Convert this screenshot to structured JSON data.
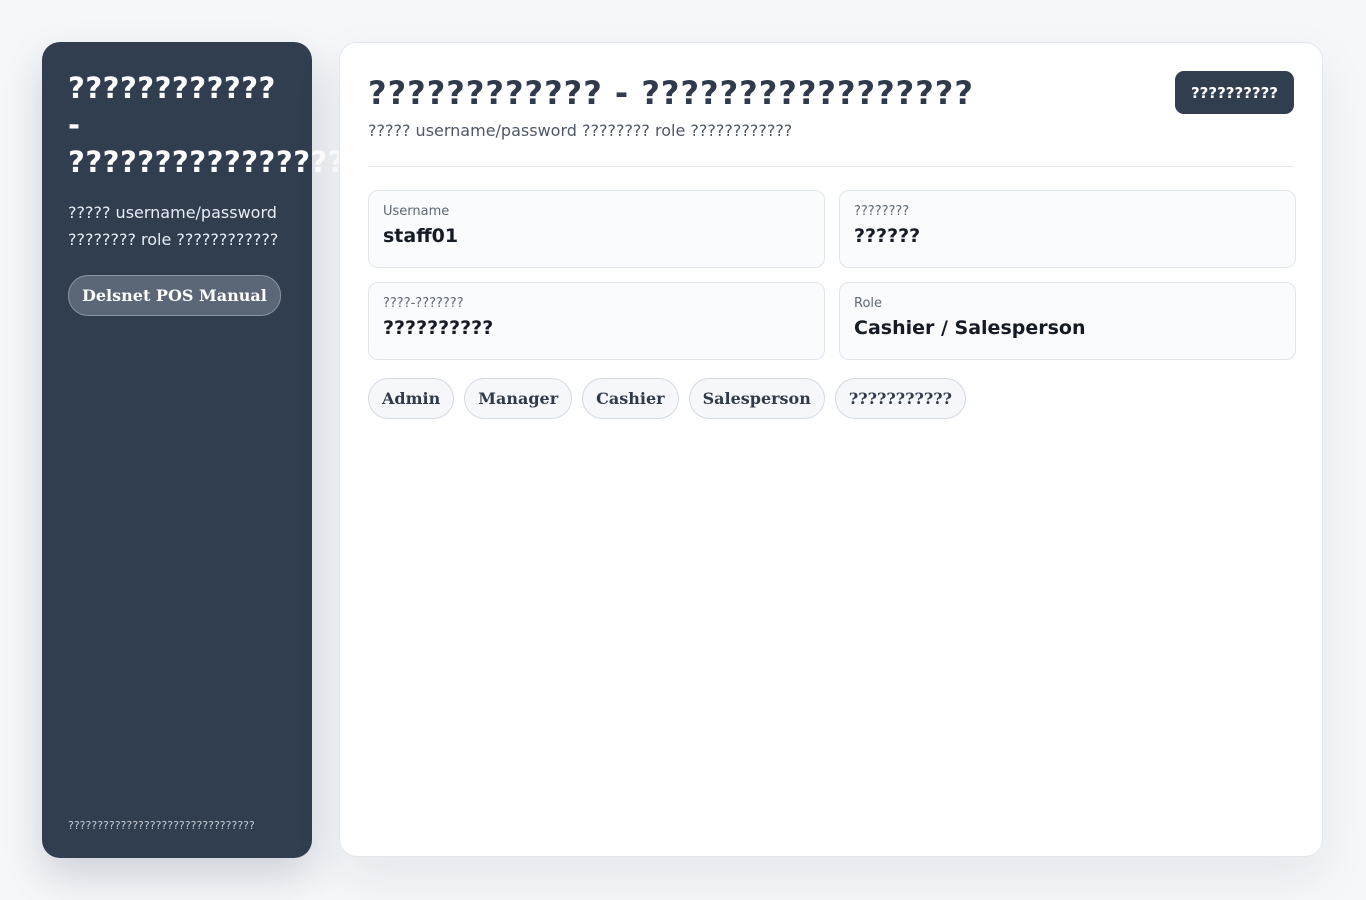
{
  "sidebar": {
    "title_lines": [
      "????????????",
      "-",
      "????????????????"
    ],
    "description": "????? username/password ???????? role ????????????",
    "manual_link": "Delsnet POS Manual",
    "footer": "????????????????????????????????"
  },
  "header": {
    "title": "???????????? - ?????????????????",
    "subtitle": "????? username/password ???????? role ????????????",
    "action_button": "??????????"
  },
  "fields": [
    {
      "label": "Username",
      "value": "staff01"
    },
    {
      "label": "????????",
      "value": "??????"
    },
    {
      "label": "????-???????",
      "value": "??????????"
    },
    {
      "label": "Role",
      "value": "Cashier / Salesperson"
    }
  ],
  "role_chips": [
    "Admin",
    "Manager",
    "Cashier",
    "Salesperson",
    "???????????"
  ],
  "colors": {
    "sidebar_bg": "#313e50",
    "accent": "#313e50",
    "page_bg": "#f5f7fa"
  }
}
